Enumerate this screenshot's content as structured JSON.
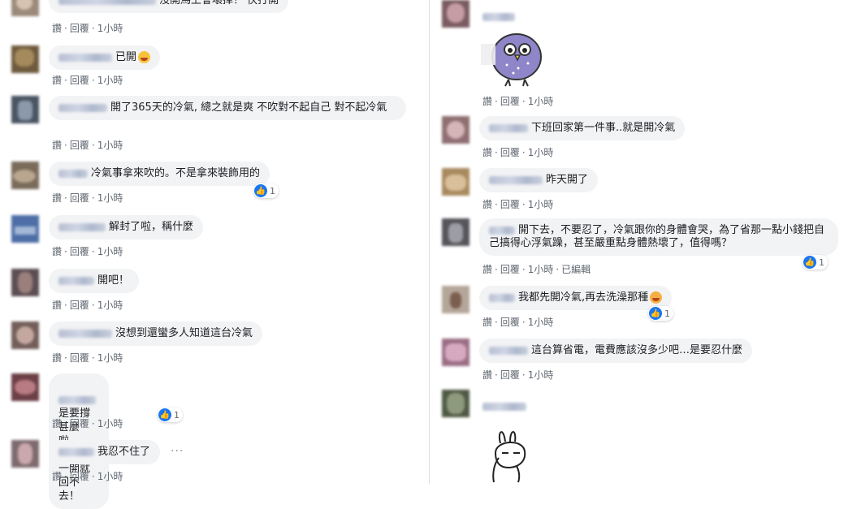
{
  "actions": {
    "like": "讚",
    "reply": "回覆",
    "time": "1小時",
    "edited": "已編輯",
    "sep": "·"
  },
  "left_comments": [
    {
      "text": "沒開馬上會壞掉！ 快打開",
      "time": "1小時"
    },
    {
      "text": "已開",
      "emoji": "smile-emoji",
      "time": "1小時"
    },
    {
      "text": "開了365天的冷氣, 總之就是爽 不吹對不起自己 對不起冷氣",
      "time": "1小時"
    },
    {
      "text": "冷氣事拿來吹的。不是拿來裝飾用的",
      "time": "1小時",
      "reactions": "1"
    },
    {
      "text": "解封了啦，稱什麼",
      "time": "1小時"
    },
    {
      "text": "開吧！",
      "time": "1小時"
    },
    {
      "text": "沒想到還蠻多人知道這台冷氣",
      "time": "1小時"
    },
    {
      "text": "是要撐甚麼啦。\n也是，一開就回不去！",
      "time": "1小時",
      "reactions": "1"
    },
    {
      "text": "我忍不住了",
      "time": "1小時",
      "more": "···"
    }
  ],
  "right_comments": [
    {
      "text": "",
      "sticker": "owl-sticker",
      "time": "1小時"
    },
    {
      "text": "下班回家第一件事..就是開冷氣",
      "time": "1小時"
    },
    {
      "text": "昨天開了",
      "time": "1小時"
    },
    {
      "text": "開下去，不要忍了，冷氣跟你的身體會哭，為了省那一點小錢把自己搞得心浮氣躁，甚至嚴重點身體熱壞了，值得嗎？",
      "time": "1小時",
      "edited": true,
      "reactions": "1"
    },
    {
      "text": "我都先開冷氣,再去洗澡那種",
      "emoji": "laugh-emoji",
      "time": "1小時",
      "reactions": "1"
    },
    {
      "text": "這台算省電，電費應該沒多少吧…是要忍什麼",
      "time": "1小時"
    },
    {
      "text": "",
      "sticker": "rabbit-sticker"
    }
  ],
  "colors": {
    "bubble": "#f2f3f5",
    "link": "#606770",
    "like_blue": "#1877f2"
  }
}
